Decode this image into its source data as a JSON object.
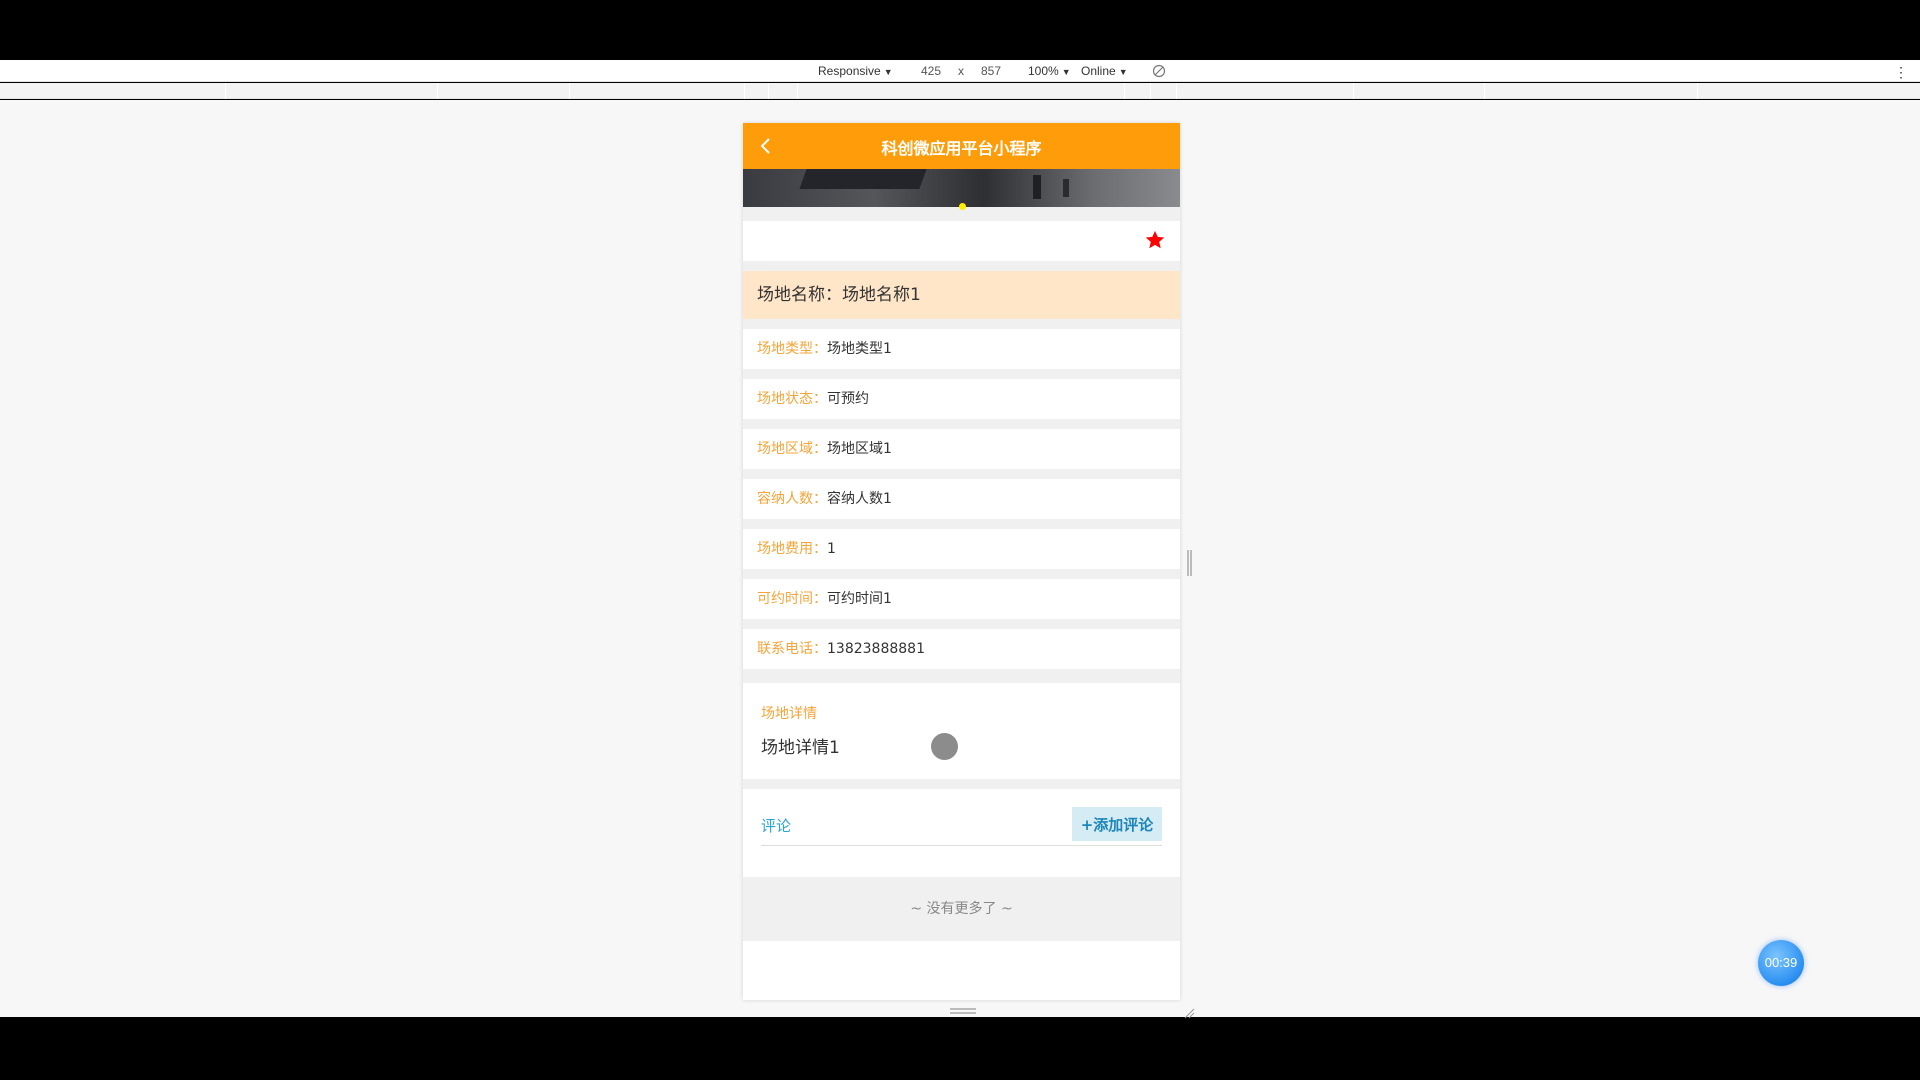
{
  "devtools": {
    "device_mode": "Responsive",
    "width": "425",
    "times": "x",
    "height": "857",
    "zoom": "100%",
    "throttle": "Online",
    "more": "⋮"
  },
  "nav": {
    "title": "科创微应用平台小程序"
  },
  "venue": {
    "name_text": "场地名称：场地名称1",
    "fields": [
      {
        "key": "场地类型：",
        "value": "场地类型1"
      },
      {
        "key": "场地状态：",
        "value": "可预约"
      },
      {
        "key": "场地区域：",
        "value": "场地区域1"
      },
      {
        "key": "容纳人数：",
        "value": "容纳人数1"
      },
      {
        "key": "场地费用：",
        "value": "1"
      },
      {
        "key": "可约时间：",
        "value": "可约时间1"
      },
      {
        "key": "联系电话：",
        "value": "13823888881"
      }
    ],
    "detail_title": "场地详情",
    "detail_body": "场地详情1"
  },
  "comments": {
    "title": "评论",
    "add_label": "+添加评论",
    "empty_text": "~ 没有更多了 ~"
  },
  "timer": {
    "label": "00:39"
  },
  "colors": {
    "nav_bg": "#ff9c0a",
    "field_key": "#f4a43a",
    "name_bg": "#ffe6c9",
    "favorite_star": "#ff0000",
    "comment_accent": "#2aa6d6"
  }
}
